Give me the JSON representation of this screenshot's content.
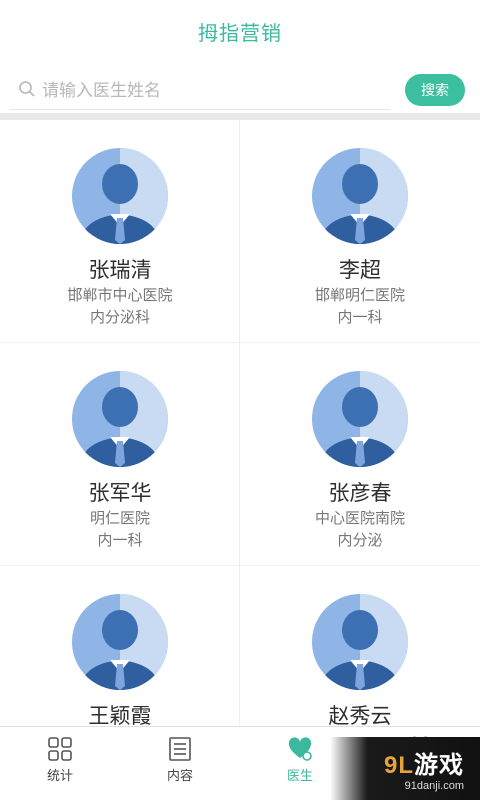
{
  "header": {
    "title": "拇指营销"
  },
  "search": {
    "placeholder": "请输入医生姓名",
    "button_label": "搜索"
  },
  "doctors": [
    {
      "name": "张瑞清",
      "hospital": "邯郸市中心医院",
      "dept": "内分泌科"
    },
    {
      "name": "李超",
      "hospital": "邯郸明仁医院",
      "dept": "内一科"
    },
    {
      "name": "张军华",
      "hospital": "明仁医院",
      "dept": "内一科"
    },
    {
      "name": "张彦春",
      "hospital": "中心医院南院",
      "dept": "内分泌"
    },
    {
      "name": "王颖霞",
      "hospital": "",
      "dept": ""
    },
    {
      "name": "赵秀云",
      "hospital": "",
      "dept": ""
    }
  ],
  "tabs": [
    {
      "label": "统计",
      "icon": "grid-icon"
    },
    {
      "label": "内容",
      "icon": "document-icon"
    },
    {
      "label": "医生",
      "icon": "doctor-icon",
      "active": true
    },
    {
      "label": "",
      "icon": "heart-icon"
    }
  ],
  "watermark": {
    "brand_num": "9L",
    "brand_text": "游戏",
    "site": "91danji.com"
  },
  "colors": {
    "accent": "#3bb89d",
    "avatar_bg": "#a9c8ee",
    "avatar_figure": "#2f5f9e"
  }
}
